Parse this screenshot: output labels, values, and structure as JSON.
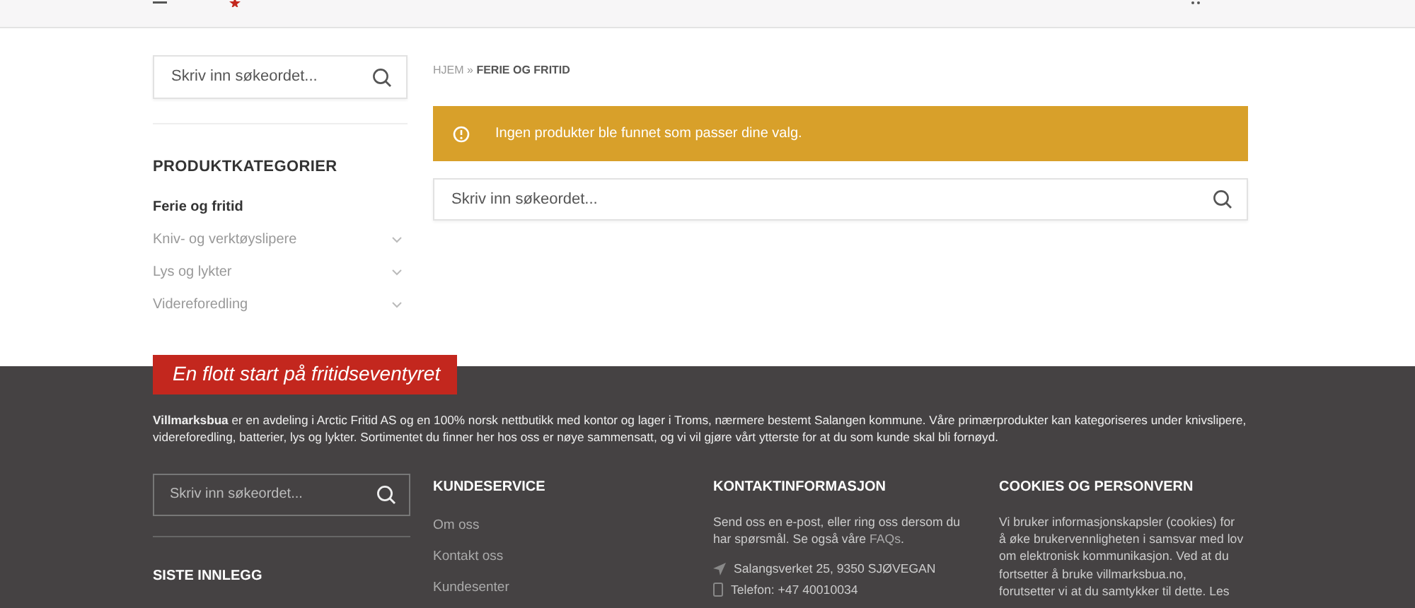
{
  "sidebar": {
    "search": {
      "placeholder": "Skriv inn søkeordet..."
    },
    "heading": "PRODUKTKATEGORIER",
    "categories": [
      {
        "label": "Ferie og fritid",
        "selected": true,
        "expandable": false
      },
      {
        "label": "Kniv- og verktøyslipere",
        "selected": false,
        "expandable": true
      },
      {
        "label": "Lys og lykter",
        "selected": false,
        "expandable": true
      },
      {
        "label": "Videreforedling",
        "selected": false,
        "expandable": true
      }
    ]
  },
  "breadcrumb": [
    {
      "label": "HJEM",
      "current": false
    },
    {
      "label": "»",
      "current": false
    },
    {
      "label": "FERIE OG FRITID",
      "current": true
    }
  ],
  "notice": "Ingen produkter ble funnet som passer dine valg.",
  "main_search": {
    "placeholder": "Skriv inn søkeordet..."
  },
  "footer": {
    "banner": "En flott start på fritidseventyret",
    "intro": "**Villmarksbua** er en avdeling i Arctic Fritid AS og en 100% norsk nettbutikk med kontor og lager i Troms, nærmere bestemt Salangen kommune. Våre primærprodukter kan kategoriseres under knivslipere, videreforedling, batterier, lys og lykter. Sortimentet du finner her hos oss er nøye sammensatt, og vi vil gjøre vårt ytterste for at du som kunde skal bli fornøyd.",
    "search": {
      "placeholder": "Skriv inn søkeordet..."
    },
    "recent_heading": "SISTE INNLEGG",
    "customer_service": {
      "heading": "KUNDESERVICE",
      "links": [
        "Om oss",
        "Kontakt oss",
        "Kundesenter"
      ]
    },
    "contact": {
      "heading": "KONTAKTINFORMASJON",
      "text": "Send oss en e-post, eller ring oss dersom du har spørsmål. Se også våre",
      "faq": "FAQs",
      "text_end": ".",
      "address": "Salangsverket 25, 9350 SJØVEGAN",
      "phone": "Telefon: +47 40010034"
    },
    "cookies": {
      "heading": "COOKIES OG PERSONVERN",
      "lines": [
        "Vi bruker informasjonskapsler (cookies) for",
        "å øke brukervennligheten i samsvar med lov",
        "om elektronisk kommunikasjon. Ved at du",
        "fortsetter å bruke villmarksbua.no,",
        "forutsetter vi at du samtykker til dette. Les"
      ]
    }
  }
}
